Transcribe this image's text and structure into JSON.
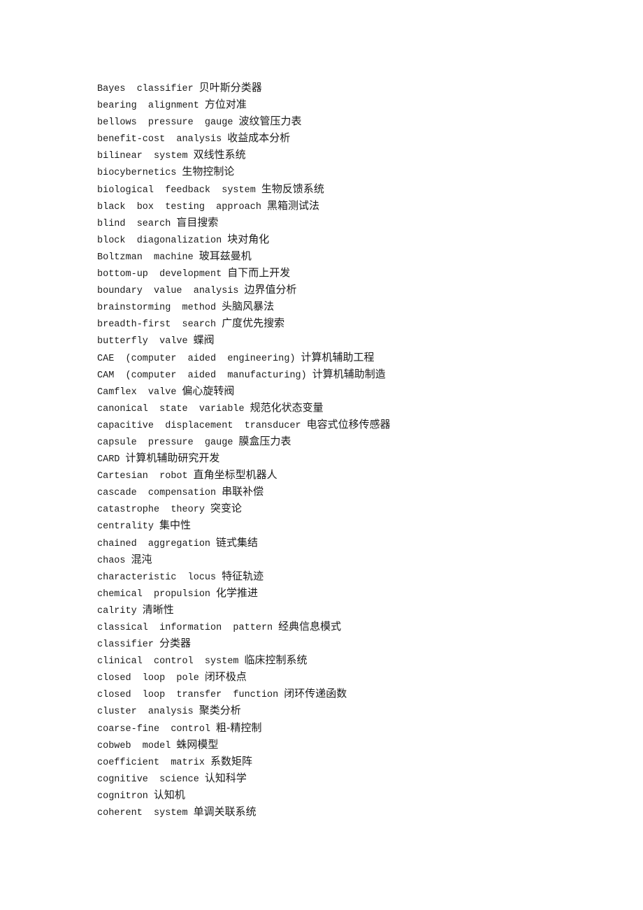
{
  "entries": [
    {
      "term": "Bayes  classifier",
      "translation": "贝叶斯分类器"
    },
    {
      "term": "bearing  alignment",
      "translation": "方位对准"
    },
    {
      "term": "bellows  pressure  gauge",
      "translation": "波纹管压力表"
    },
    {
      "term": "benefit-cost  analysis",
      "translation": "收益成本分析"
    },
    {
      "term": "bilinear  system",
      "translation": "双线性系统"
    },
    {
      "term": "biocybernetics",
      "translation": "生物控制论"
    },
    {
      "term": "biological  feedback  system",
      "translation": "生物反馈系统"
    },
    {
      "term": "black  box  testing  approach",
      "translation": "黑箱测试法"
    },
    {
      "term": "blind  search",
      "translation": "盲目搜索"
    },
    {
      "term": "block  diagonalization",
      "translation": "块对角化"
    },
    {
      "term": "Boltzman  machine",
      "translation": "玻耳兹曼机"
    },
    {
      "term": "bottom-up  development",
      "translation": "自下而上开发"
    },
    {
      "term": "boundary  value  analysis",
      "translation": "边界值分析"
    },
    {
      "term": "brainstorming  method",
      "translation": "头脑风暴法"
    },
    {
      "term": "breadth-first  search",
      "translation": "广度优先搜索"
    },
    {
      "term": "butterfly  valve",
      "translation": "蝶阀"
    },
    {
      "term": "CAE  (computer  aided  engineering)",
      "translation": "计算机辅助工程"
    },
    {
      "term": "CAM  (computer  aided  manufacturing)",
      "translation": "计算机辅助制造"
    },
    {
      "term": "Camflex  valve",
      "translation": "偏心旋转阀"
    },
    {
      "term": "canonical  state  variable",
      "translation": "规范化状态变量"
    },
    {
      "term": "capacitive  displacement  transducer",
      "translation": "电容式位移传感器"
    },
    {
      "term": "capsule  pressure  gauge",
      "translation": "膜盒压力表"
    },
    {
      "term": "CARD",
      "translation": "计算机辅助研究开发"
    },
    {
      "term": "Cartesian  robot",
      "translation": "直角坐标型机器人"
    },
    {
      "term": "cascade  compensation",
      "translation": "串联补偿"
    },
    {
      "term": "catastrophe  theory",
      "translation": "突变论"
    },
    {
      "term": "centrality",
      "translation": "集中性"
    },
    {
      "term": "chained  aggregation",
      "translation": "链式集结"
    },
    {
      "term": "chaos",
      "translation": "混沌"
    },
    {
      "term": "characteristic  locus",
      "translation": "特征轨迹"
    },
    {
      "term": "chemical  propulsion",
      "translation": "化学推进"
    },
    {
      "term": "calrity",
      "translation": "清晰性"
    },
    {
      "term": "classical  information  pattern",
      "translation": "经典信息模式"
    },
    {
      "term": "classifier",
      "translation": "分类器"
    },
    {
      "term": "clinical  control  system",
      "translation": "临床控制系统"
    },
    {
      "term": "closed  loop  pole",
      "translation": "闭环极点"
    },
    {
      "term": "closed  loop  transfer  function",
      "translation": "闭环传递函数"
    },
    {
      "term": "cluster  analysis",
      "translation": "聚类分析"
    },
    {
      "term": "coarse-fine  control",
      "translation": "粗-精控制"
    },
    {
      "term": "cobweb  model",
      "translation": "蛛网模型"
    },
    {
      "term": "coefficient  matrix",
      "translation": "系数矩阵"
    },
    {
      "term": "cognitive  science",
      "translation": "认知科学"
    },
    {
      "term": "cognitron",
      "translation": "认知机"
    },
    {
      "term": "coherent  system",
      "translation": "单调关联系统"
    }
  ]
}
